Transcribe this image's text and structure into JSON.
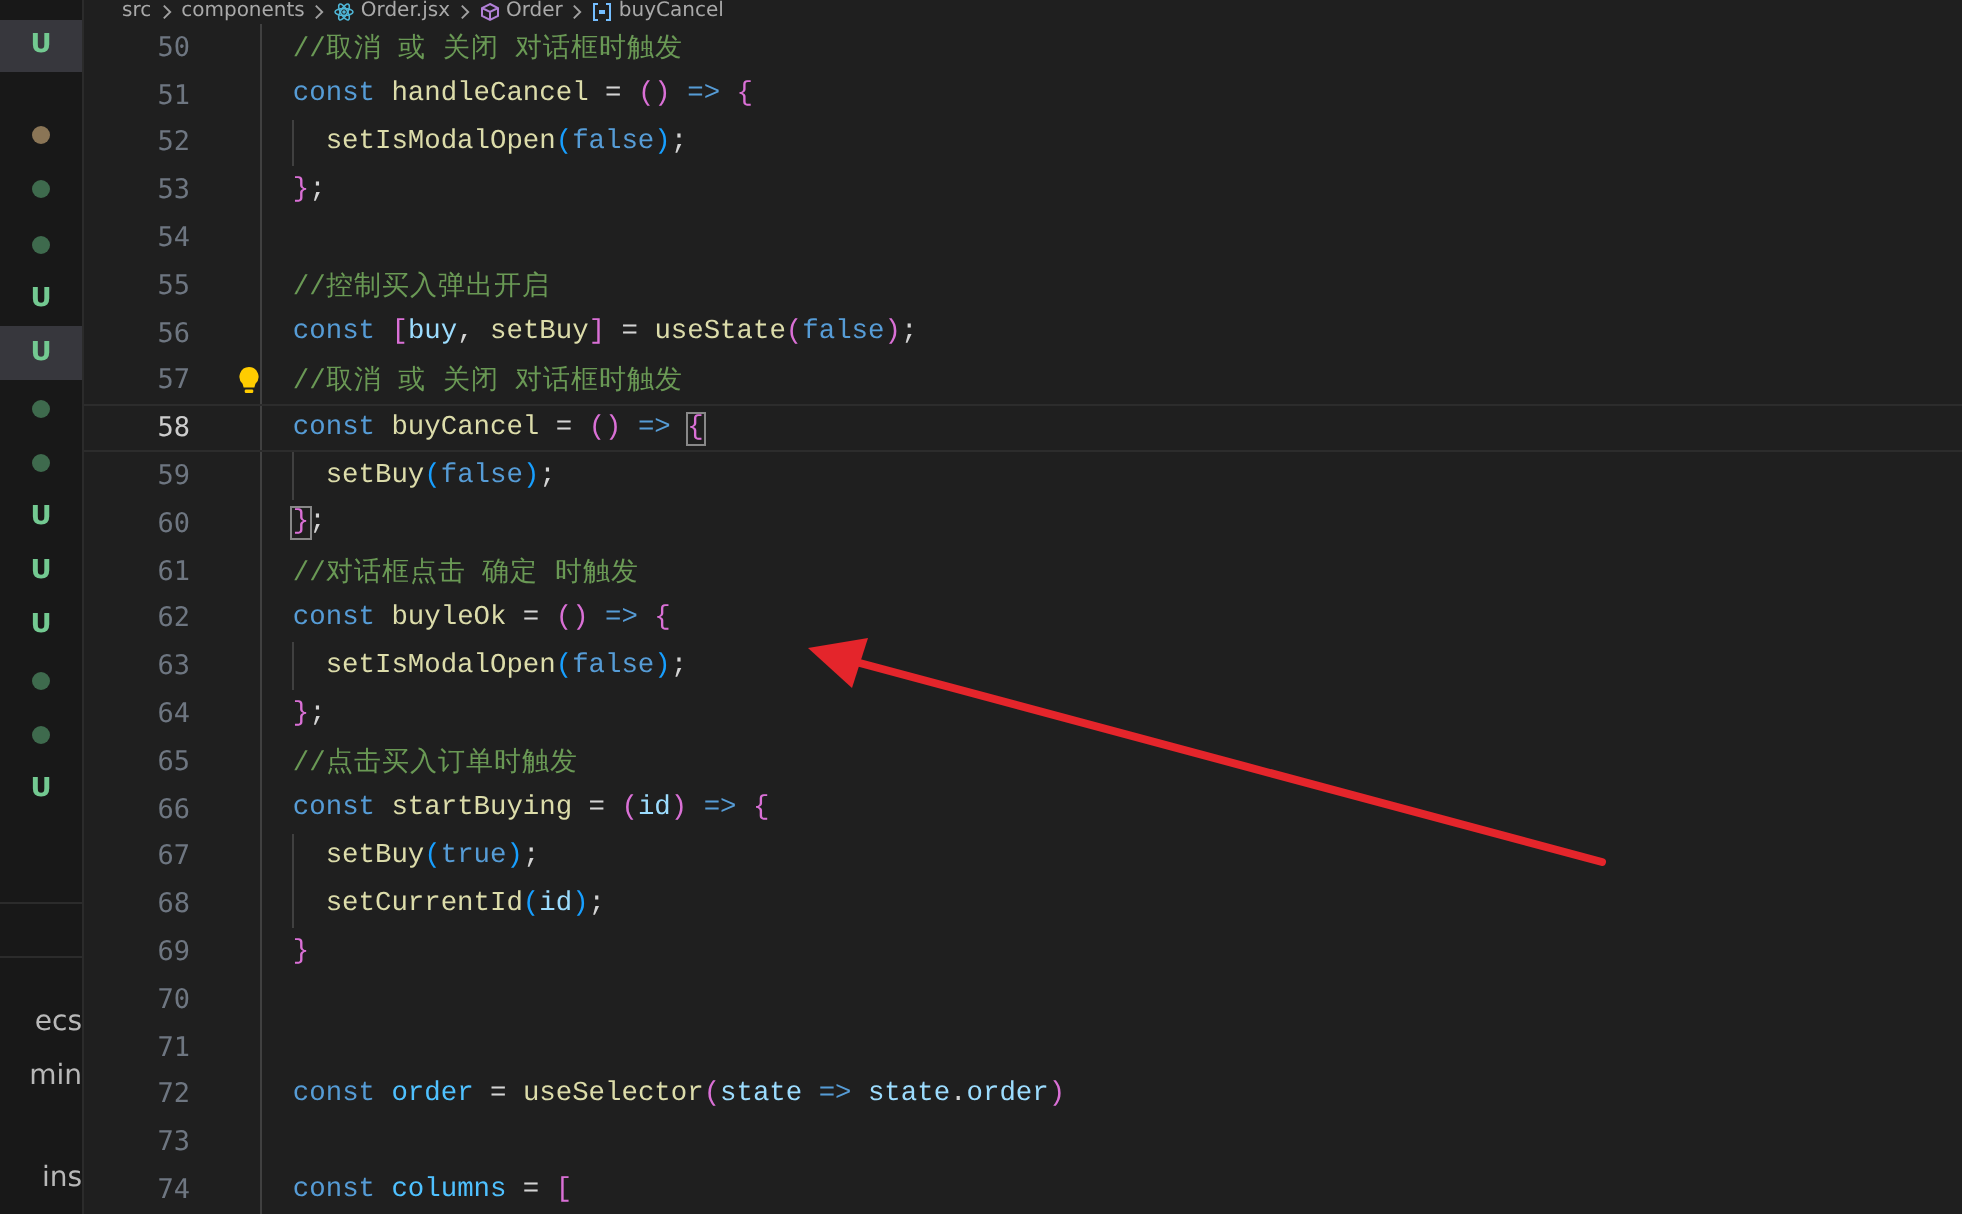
{
  "breadcrumb": [
    {
      "kind": "folder",
      "text": "src"
    },
    {
      "kind": "folder",
      "text": "components"
    },
    {
      "kind": "react-file",
      "text": "Order.jsx"
    },
    {
      "kind": "component",
      "text": "Order"
    },
    {
      "kind": "variable",
      "text": "buyCancel"
    }
  ],
  "explorer_badges": [
    {
      "kind": "letter",
      "text": "U",
      "selected": true
    },
    {
      "kind": "dot",
      "color": "#8a7556",
      "selected": false
    },
    {
      "kind": "dot",
      "color": "#3e6a4d",
      "selected": false
    },
    {
      "kind": "dot",
      "color": "#3e6a4d",
      "selected": false
    },
    {
      "kind": "letter",
      "text": "U",
      "selected": false
    },
    {
      "kind": "letter",
      "text": "U",
      "selected": true
    },
    {
      "kind": "dot",
      "color": "#3e6a4d",
      "selected": false
    },
    {
      "kind": "dot",
      "color": "#3e6a4d",
      "selected": false
    },
    {
      "kind": "letter",
      "text": "U",
      "selected": false
    },
    {
      "kind": "letter",
      "text": "U",
      "selected": false
    },
    {
      "kind": "letter",
      "text": "U",
      "selected": false
    },
    {
      "kind": "dot",
      "color": "#3e6a4d",
      "selected": false
    },
    {
      "kind": "dot",
      "color": "#3e6a4d",
      "selected": false
    },
    {
      "kind": "letter",
      "text": "U",
      "selected": false
    }
  ],
  "sidebar_texts": [
    "ecs",
    "min",
    "ins"
  ],
  "editor": {
    "lines": [
      {
        "number": "50",
        "current": false,
        "lightbulb": false,
        "nested": false,
        "tokens": [
          {
            "kind": "comment",
            "text": "//取消 或 关闭 对话框时触发"
          }
        ]
      },
      {
        "number": "51",
        "current": false,
        "lightbulb": false,
        "nested": false,
        "tokens": [
          {
            "kind": "keyword",
            "text": "const "
          },
          {
            "kind": "function",
            "text": "handleCancel"
          },
          {
            "kind": "operator",
            "text": " = "
          },
          {
            "kind": "bracket2",
            "text": "()"
          },
          {
            "kind": "keyword",
            "text": " => "
          },
          {
            "kind": "bracket2",
            "text": "{"
          }
        ]
      },
      {
        "number": "52",
        "current": false,
        "lightbulb": false,
        "nested": true,
        "tokens": [
          {
            "kind": "function",
            "text": "setIsModalOpen"
          },
          {
            "kind": "bracket3",
            "text": "("
          },
          {
            "kind": "keyword",
            "text": "false"
          },
          {
            "kind": "bracket3",
            "text": ")"
          },
          {
            "kind": "operator",
            "text": ";"
          }
        ]
      },
      {
        "number": "53",
        "current": false,
        "lightbulb": false,
        "nested": false,
        "tokens": [
          {
            "kind": "bracket2",
            "text": "}"
          },
          {
            "kind": "operator",
            "text": ";"
          }
        ]
      },
      {
        "number": "54",
        "current": false,
        "lightbulb": false,
        "nested": false
      },
      {
        "number": "55",
        "current": false,
        "lightbulb": false,
        "nested": false,
        "tokens": [
          {
            "kind": "comment",
            "text": "//控制买入弹出开启"
          }
        ]
      },
      {
        "number": "56",
        "current": false,
        "lightbulb": false,
        "nested": false,
        "tokens": [
          {
            "kind": "keyword",
            "text": "const "
          },
          {
            "kind": "bracket2",
            "text": "["
          },
          {
            "kind": "variable",
            "text": "buy"
          },
          {
            "kind": "operator",
            "text": ", "
          },
          {
            "kind": "function",
            "text": "setBuy"
          },
          {
            "kind": "bracket2",
            "text": "]"
          },
          {
            "kind": "operator",
            "text": " = "
          },
          {
            "kind": "function",
            "text": "useState"
          },
          {
            "kind": "bracket2",
            "text": "("
          },
          {
            "kind": "keyword",
            "text": "false"
          },
          {
            "kind": "bracket2",
            "text": ")"
          },
          {
            "kind": "operator",
            "text": ";"
          }
        ]
      },
      {
        "number": "57",
        "current": false,
        "lightbulb": true,
        "nested": false,
        "tokens": [
          {
            "kind": "comment",
            "text": "//取消 或 关闭 对话框时触发"
          }
        ]
      },
      {
        "number": "58",
        "current": true,
        "lightbulb": false,
        "nested": false,
        "tokens": [
          {
            "kind": "keyword",
            "text": "const "
          },
          {
            "kind": "function",
            "text": "buyCancel"
          },
          {
            "kind": "operator",
            "text": " = "
          },
          {
            "kind": "bracket2",
            "text": "()"
          },
          {
            "kind": "keyword",
            "text": " => "
          },
          {
            "kind": "bracket2-match",
            "text": "{"
          }
        ]
      },
      {
        "number": "59",
        "current": false,
        "lightbulb": false,
        "nested": true,
        "tokens": [
          {
            "kind": "function",
            "text": "setBuy"
          },
          {
            "kind": "bracket3",
            "text": "("
          },
          {
            "kind": "keyword",
            "text": "false"
          },
          {
            "kind": "bracket3",
            "text": ")"
          },
          {
            "kind": "operator",
            "text": ";"
          }
        ]
      },
      {
        "number": "60",
        "current": false,
        "lightbulb": false,
        "nested": false,
        "tokens": [
          {
            "kind": "bracket2-match",
            "text": "}"
          },
          {
            "kind": "operator",
            "text": ";"
          }
        ]
      },
      {
        "number": "61",
        "current": false,
        "lightbulb": false,
        "nested": false,
        "tokens": [
          {
            "kind": "comment",
            "text": "//对话框点击 确定 时触发"
          }
        ]
      },
      {
        "number": "62",
        "current": false,
        "lightbulb": false,
        "nested": false,
        "tokens": [
          {
            "kind": "keyword",
            "text": "const "
          },
          {
            "kind": "function",
            "text": "buyleOk"
          },
          {
            "kind": "operator",
            "text": " = "
          },
          {
            "kind": "bracket2",
            "text": "()"
          },
          {
            "kind": "keyword",
            "text": " => "
          },
          {
            "kind": "bracket2",
            "text": "{"
          }
        ]
      },
      {
        "number": "63",
        "current": false,
        "lightbulb": false,
        "nested": true,
        "tokens": [
          {
            "kind": "function",
            "text": "setIsModalOpen"
          },
          {
            "kind": "bracket3",
            "text": "("
          },
          {
            "kind": "keyword",
            "text": "false"
          },
          {
            "kind": "bracket3",
            "text": ")"
          },
          {
            "kind": "operator",
            "text": ";"
          }
        ]
      },
      {
        "number": "64",
        "current": false,
        "lightbulb": false,
        "nested": false,
        "tokens": [
          {
            "kind": "bracket2",
            "text": "}"
          },
          {
            "kind": "operator",
            "text": ";"
          }
        ]
      },
      {
        "number": "65",
        "current": false,
        "lightbulb": false,
        "nested": false,
        "tokens": [
          {
            "kind": "comment",
            "text": "//点击买入订单时触发"
          }
        ]
      },
      {
        "number": "66",
        "current": false,
        "lightbulb": false,
        "nested": false,
        "tokens": [
          {
            "kind": "keyword",
            "text": "const "
          },
          {
            "kind": "function",
            "text": "startBuying"
          },
          {
            "kind": "operator",
            "text": " = "
          },
          {
            "kind": "bracket2",
            "text": "("
          },
          {
            "kind": "variable",
            "text": "id"
          },
          {
            "kind": "bracket2",
            "text": ")"
          },
          {
            "kind": "keyword",
            "text": " => "
          },
          {
            "kind": "bracket2",
            "text": "{"
          }
        ]
      },
      {
        "number": "67",
        "current": false,
        "lightbulb": false,
        "nested": true,
        "tokens": [
          {
            "kind": "function",
            "text": "setBuy"
          },
          {
            "kind": "bracket3",
            "text": "("
          },
          {
            "kind": "keyword",
            "text": "true"
          },
          {
            "kind": "bracket3",
            "text": ")"
          },
          {
            "kind": "operator",
            "text": ";"
          }
        ]
      },
      {
        "number": "68",
        "current": false,
        "lightbulb": false,
        "nested": true,
        "tokens": [
          {
            "kind": "function",
            "text": "setCurrentId"
          },
          {
            "kind": "bracket3",
            "text": "("
          },
          {
            "kind": "variable",
            "text": "id"
          },
          {
            "kind": "bracket3",
            "text": ")"
          },
          {
            "kind": "operator",
            "text": ";"
          }
        ]
      },
      {
        "number": "69",
        "current": false,
        "lightbulb": false,
        "nested": false,
        "tokens": [
          {
            "kind": "bracket2",
            "text": "}"
          }
        ]
      },
      {
        "number": "70",
        "current": false,
        "lightbulb": false,
        "nested": false
      },
      {
        "number": "71",
        "current": false,
        "lightbulb": false,
        "nested": false
      },
      {
        "number": "72",
        "current": false,
        "lightbulb": false,
        "nested": false,
        "tokens": [
          {
            "kind": "keyword",
            "text": "const "
          },
          {
            "kind": "constant",
            "text": "order"
          },
          {
            "kind": "operator",
            "text": " = "
          },
          {
            "kind": "function",
            "text": "useSelector"
          },
          {
            "kind": "bracket2",
            "text": "("
          },
          {
            "kind": "variable",
            "text": "state"
          },
          {
            "kind": "keyword",
            "text": " => "
          },
          {
            "kind": "variable",
            "text": "state"
          },
          {
            "kind": "operator",
            "text": "."
          },
          {
            "kind": "variable",
            "text": "order"
          },
          {
            "kind": "bracket2",
            "text": ")"
          }
        ]
      },
      {
        "number": "73",
        "current": false,
        "lightbulb": false,
        "nested": false
      },
      {
        "number": "74",
        "current": false,
        "lightbulb": false,
        "nested": false,
        "tokens": [
          {
            "kind": "keyword",
            "text": "const "
          },
          {
            "kind": "constant",
            "text": "columns"
          },
          {
            "kind": "operator",
            "text": " = "
          },
          {
            "kind": "bracket2",
            "text": "["
          }
        ]
      }
    ]
  }
}
